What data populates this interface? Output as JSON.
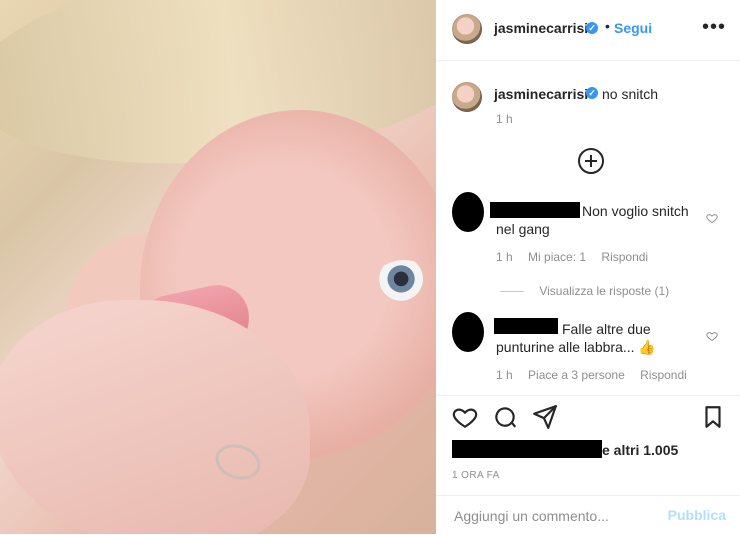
{
  "post": {
    "author": {
      "username": "jasminecarrisi",
      "verified": true,
      "verified_icon": "verified-badge-icon"
    },
    "header": {
      "dot": "•",
      "follow_label": "Segui",
      "more_label": "•••"
    },
    "caption": {
      "text": "no snitch",
      "time": "1 h"
    },
    "load_more_icon": "plus-circle-icon",
    "comments": [
      {
        "text_before": "Non voglio snitch",
        "text_after": "nel gang",
        "time": "1 h",
        "likes": "Mi piace: 1",
        "reply": "Rispondi",
        "view_replies": "Visualizza le risposte (1)"
      },
      {
        "text_before": "Falle altre due",
        "text_after": "punturine alle labbra... 👍",
        "time": "1 h",
        "likes": "Piace a 3 persone",
        "reply": "Rispondi"
      }
    ],
    "actions": {
      "icons": [
        "heart-icon",
        "comment-icon",
        "share-icon",
        "bookmark-icon"
      ]
    },
    "likes_summary": {
      "text": "e altri 1.005"
    },
    "posted_ago": "1 ORA FA",
    "composer": {
      "placeholder": "Aggiungi un commento...",
      "publish_label": "Pubblica"
    }
  },
  "colors": {
    "accent": "#3897f0",
    "muted": "#8e8e8e",
    "text": "#262626",
    "publish_disabled": "#b2dffc"
  }
}
